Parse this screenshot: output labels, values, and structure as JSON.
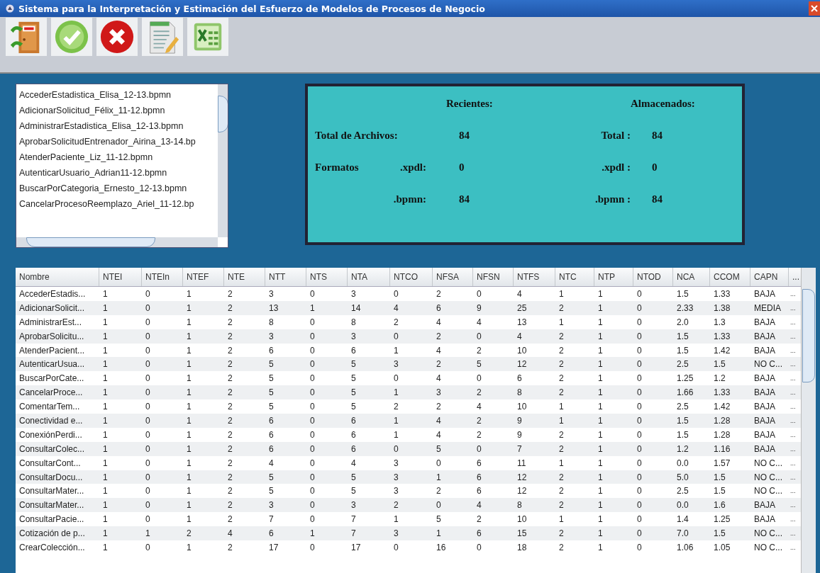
{
  "window": {
    "title": "Sistema para la Interpretación y Estimación del Esfuerzo de Modelos de Procesos de Negocio"
  },
  "toolbar": [
    {
      "kind": "exit"
    },
    {
      "kind": "accept"
    },
    {
      "kind": "cancel"
    },
    {
      "kind": "report"
    },
    {
      "kind": "excel"
    }
  ],
  "file_list": [
    "AccederEstadistica_Elisa_12-13.bpmn",
    "AdicionarSolicitud_Félix_11-12.bpmn",
    "AdministrarEstadistica_Elisa_12-13.bpmn",
    "AprobarSolicitudEntrenador_Airina_13-14.bp",
    "AtenderPaciente_Liz_11-12.bpmn",
    "AutenticarUsuario_Adrian11-12.bpmn",
    "BuscarPorCategoria_Ernesto_12-13.bpmn",
    "CancelarProcesoReemplazo_Ariel_11-12.bp"
  ],
  "summary": {
    "recent_heading": "Recientes:",
    "stored_heading": "Almacenados:",
    "rows": [
      {
        "label": "Total de Archivos:",
        "prefix": "",
        "recent": "84",
        "stored_label": "Total :",
        "stored": "84"
      },
      {
        "label": ".xpdl:",
        "prefix": "Formatos",
        "recent": "0",
        "stored_label": ".xpdl :",
        "stored": "0"
      },
      {
        "label": ".bpmn:",
        "prefix": "",
        "recent": "84",
        "stored_label": ".bpmn :",
        "stored": "84"
      }
    ]
  },
  "table": {
    "columns": [
      "Nombre",
      "NTEI",
      "NTEIn",
      "NTEF",
      "NTE",
      "NTT",
      "NTS",
      "NTA",
      "NTCO",
      "NFSA",
      "NFSN",
      "NTFS",
      "NTC",
      "NTP",
      "NTOD",
      "NCA",
      "CCOM",
      "CAPN",
      "..."
    ],
    "rows": [
      [
        "AccederEstadis...",
        "1",
        "0",
        "1",
        "2",
        "3",
        "0",
        "3",
        "0",
        "2",
        "0",
        "4",
        "1",
        "1",
        "0",
        "1.5",
        "1.33",
        "BAJA",
        "..."
      ],
      [
        "AdicionarSolicit...",
        "1",
        "0",
        "1",
        "2",
        "13",
        "1",
        "14",
        "4",
        "6",
        "9",
        "25",
        "2",
        "1",
        "0",
        "2.33",
        "1.38",
        "MEDIA",
        "..."
      ],
      [
        "AdministrarEst...",
        "1",
        "0",
        "1",
        "2",
        "8",
        "0",
        "8",
        "2",
        "4",
        "4",
        "13",
        "1",
        "1",
        "0",
        "2.0",
        "1.3",
        "BAJA",
        "..."
      ],
      [
        "AprobarSolicitu...",
        "1",
        "0",
        "1",
        "2",
        "3",
        "0",
        "3",
        "0",
        "2",
        "0",
        "4",
        "2",
        "1",
        "0",
        "1.5",
        "1.33",
        "BAJA",
        "..."
      ],
      [
        "AtenderPacient...",
        "1",
        "0",
        "1",
        "2",
        "6",
        "0",
        "6",
        "1",
        "4",
        "2",
        "10",
        "2",
        "1",
        "0",
        "1.5",
        "1.42",
        "BAJA",
        "..."
      ],
      [
        "AutenticarUsua...",
        "1",
        "0",
        "1",
        "2",
        "5",
        "0",
        "5",
        "3",
        "2",
        "5",
        "12",
        "2",
        "1",
        "0",
        "2.5",
        "1.5",
        "NO C...",
        "..."
      ],
      [
        "BuscarPorCate...",
        "1",
        "0",
        "1",
        "2",
        "5",
        "0",
        "5",
        "0",
        "4",
        "0",
        "6",
        "2",
        "1",
        "0",
        "1.25",
        "1.2",
        "BAJA",
        "..."
      ],
      [
        "CancelarProce...",
        "1",
        "0",
        "1",
        "2",
        "5",
        "0",
        "5",
        "1",
        "3",
        "2",
        "8",
        "2",
        "1",
        "0",
        "1.66",
        "1.33",
        "BAJA",
        "..."
      ],
      [
        "ComentarTem...",
        "1",
        "0",
        "1",
        "2",
        "5",
        "0",
        "5",
        "2",
        "2",
        "4",
        "10",
        "1",
        "1",
        "0",
        "2.5",
        "1.42",
        "BAJA",
        "..."
      ],
      [
        "Conectividad e...",
        "1",
        "0",
        "1",
        "2",
        "6",
        "0",
        "6",
        "1",
        "4",
        "2",
        "9",
        "1",
        "1",
        "0",
        "1.5",
        "1.28",
        "BAJA",
        "..."
      ],
      [
        "ConexiónPerdi...",
        "1",
        "0",
        "1",
        "2",
        "6",
        "0",
        "6",
        "1",
        "4",
        "2",
        "9",
        "2",
        "1",
        "0",
        "1.5",
        "1.28",
        "BAJA",
        "..."
      ],
      [
        "ConsultarColec...",
        "1",
        "0",
        "1",
        "2",
        "6",
        "0",
        "6",
        "0",
        "5",
        "0",
        "7",
        "2",
        "1",
        "0",
        "1.2",
        "1.16",
        "BAJA",
        "..."
      ],
      [
        "ConsultarCont...",
        "1",
        "0",
        "1",
        "2",
        "4",
        "0",
        "4",
        "3",
        "0",
        "6",
        "11",
        "1",
        "1",
        "0",
        "0.0",
        "1.57",
        "NO C...",
        "..."
      ],
      [
        "ConsultarDocu...",
        "1",
        "0",
        "1",
        "2",
        "5",
        "0",
        "5",
        "3",
        "1",
        "6",
        "12",
        "2",
        "1",
        "0",
        "5.0",
        "1.5",
        "NO C...",
        "..."
      ],
      [
        "ConsultarMater...",
        "1",
        "0",
        "1",
        "2",
        "5",
        "0",
        "5",
        "3",
        "2",
        "6",
        "12",
        "2",
        "1",
        "0",
        "2.5",
        "1.5",
        "NO C...",
        "..."
      ],
      [
        "ConsultarMater...",
        "1",
        "0",
        "1",
        "2",
        "3",
        "0",
        "3",
        "2",
        "0",
        "4",
        "8",
        "2",
        "1",
        "0",
        "0.0",
        "1.6",
        "BAJA",
        "..."
      ],
      [
        "ConsultarPacie...",
        "1",
        "0",
        "1",
        "2",
        "7",
        "0",
        "7",
        "1",
        "5",
        "2",
        "10",
        "1",
        "1",
        "0",
        "1.4",
        "1.25",
        "BAJA",
        "..."
      ],
      [
        "Cotización de p...",
        "1",
        "1",
        "2",
        "4",
        "6",
        "1",
        "7",
        "3",
        "1",
        "6",
        "15",
        "2",
        "1",
        "0",
        "7.0",
        "1.5",
        "NO C...",
        "..."
      ],
      [
        "CrearColección...",
        "1",
        "0",
        "1",
        "2",
        "17",
        "0",
        "17",
        "0",
        "16",
        "0",
        "18",
        "2",
        "1",
        "0",
        "1.06",
        "1.05",
        "NO C...",
        "..."
      ]
    ]
  }
}
